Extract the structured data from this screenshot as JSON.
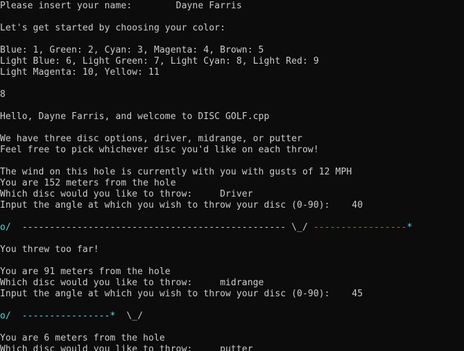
{
  "console": {
    "lines": [
      {
        "text": "Please insert your name:        Dayne Farris"
      },
      {
        "text": ""
      },
      {
        "text": "Let's get started by choosing your color:"
      },
      {
        "text": ""
      },
      {
        "text": "Blue: 1, Green: 2, Cyan: 3, Magenta: 4, Brown: 5"
      },
      {
        "text": "Light Blue: 6, Light Green: 7, Light Cyan: 8, Light Red: 9"
      },
      {
        "text": "Light Magenta: 10, Yellow: 11"
      },
      {
        "text": ""
      },
      {
        "text": "8"
      },
      {
        "text": ""
      },
      {
        "text": "Hello, Dayne Farris, and welcome to DISC GOLF.cpp"
      },
      {
        "text": ""
      },
      {
        "text": "We have three disc options, driver, midrange, or putter"
      },
      {
        "text": "Feel free to pick whichever disc you'd like on each throw!"
      },
      {
        "text": ""
      },
      {
        "text": "The wind on this hole is currently with you with gusts of 12 MPH"
      },
      {
        "text": "You are 152 meters from the hole"
      },
      {
        "text": "Which disc would you like to throw:     Driver"
      },
      {
        "text": "Input the angle at which you wish to throw your disc (0-90):    40"
      },
      {
        "text": ""
      },
      {
        "segments": [
          {
            "text": "o/  ",
            "color": "cyan"
          },
          {
            "text": "------------------------------------------------ \\_/ ",
            "color": "gray"
          },
          {
            "text": "-----------------",
            "color": "red"
          },
          {
            "text": "*",
            "color": "cyan"
          }
        ]
      },
      {
        "text": ""
      },
      {
        "text": "You threw too far!"
      },
      {
        "text": ""
      },
      {
        "text": "You are 91 meters from the hole"
      },
      {
        "text": "Which disc would you like to throw:     midrange"
      },
      {
        "text": "Input the angle at which you wish to throw your disc (0-90):    45"
      },
      {
        "text": ""
      },
      {
        "segments": [
          {
            "text": "o/  ",
            "color": "cyan"
          },
          {
            "text": "----------------*",
            "color": "cyan"
          },
          {
            "text": "  \\_/",
            "color": "gray"
          }
        ]
      },
      {
        "text": ""
      },
      {
        "text": "You are 6 meters from the hole"
      },
      {
        "text": "Which disc would you like to throw:     putter"
      }
    ]
  },
  "colors": {
    "background": "#0c0c0c",
    "gray": "#cccccc",
    "cyan": "#61d6d6",
    "red": "#e74856"
  }
}
